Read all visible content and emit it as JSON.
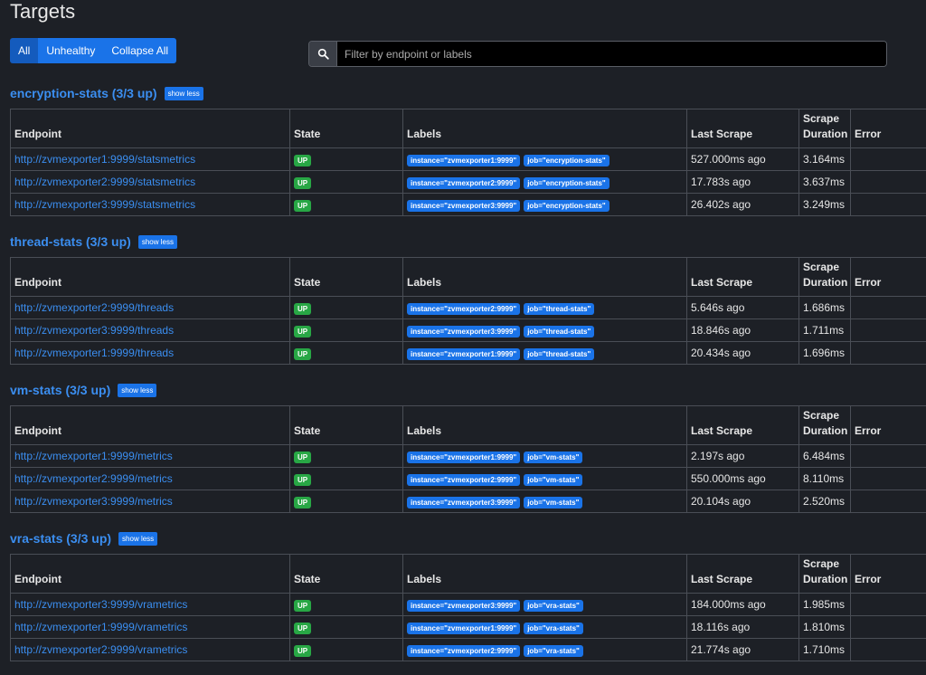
{
  "page": {
    "title": "Targets"
  },
  "filters": {
    "all": "All",
    "unhealthy": "Unhealthy",
    "collapse": "Collapse All"
  },
  "search": {
    "placeholder": "Filter by endpoint or labels"
  },
  "table_headers": {
    "endpoint": "Endpoint",
    "state": "State",
    "labels": "Labels",
    "last_scrape": "Last Scrape",
    "scrape_duration_1": "Scrape",
    "scrape_duration_2": "Duration",
    "error": "Error"
  },
  "show_less_label": "show less",
  "colors": {
    "accent": "#1a73e8",
    "link": "#3b8ef0",
    "up": "#28a745",
    "background": "#1d2026"
  },
  "sections": [
    {
      "title": "encryption-stats (3/3 up)",
      "rows": [
        {
          "endpoint": "http://zvmexporter1:9999/statsmetrics",
          "state": "UP",
          "labels": [
            "instance=\"zvmexporter1:9999\"",
            "job=\"encryption-stats\""
          ],
          "last_scrape": "527.000ms ago",
          "duration": "3.164ms",
          "error": ""
        },
        {
          "endpoint": "http://zvmexporter2:9999/statsmetrics",
          "state": "UP",
          "labels": [
            "instance=\"zvmexporter2:9999\"",
            "job=\"encryption-stats\""
          ],
          "last_scrape": "17.783s ago",
          "duration": "3.637ms",
          "error": ""
        },
        {
          "endpoint": "http://zvmexporter3:9999/statsmetrics",
          "state": "UP",
          "labels": [
            "instance=\"zvmexporter3:9999\"",
            "job=\"encryption-stats\""
          ],
          "last_scrape": "26.402s ago",
          "duration": "3.249ms",
          "error": ""
        }
      ]
    },
    {
      "title": "thread-stats (3/3 up)",
      "rows": [
        {
          "endpoint": "http://zvmexporter2:9999/threads",
          "state": "UP",
          "labels": [
            "instance=\"zvmexporter2:9999\"",
            "job=\"thread-stats\""
          ],
          "last_scrape": "5.646s ago",
          "duration": "1.686ms",
          "error": ""
        },
        {
          "endpoint": "http://zvmexporter3:9999/threads",
          "state": "UP",
          "labels": [
            "instance=\"zvmexporter3:9999\"",
            "job=\"thread-stats\""
          ],
          "last_scrape": "18.846s ago",
          "duration": "1.711ms",
          "error": ""
        },
        {
          "endpoint": "http://zvmexporter1:9999/threads",
          "state": "UP",
          "labels": [
            "instance=\"zvmexporter1:9999\"",
            "job=\"thread-stats\""
          ],
          "last_scrape": "20.434s ago",
          "duration": "1.696ms",
          "error": ""
        }
      ]
    },
    {
      "title": "vm-stats (3/3 up)",
      "rows": [
        {
          "endpoint": "http://zvmexporter1:9999/metrics",
          "state": "UP",
          "labels": [
            "instance=\"zvmexporter1:9999\"",
            "job=\"vm-stats\""
          ],
          "last_scrape": "2.197s ago",
          "duration": "6.484ms",
          "error": ""
        },
        {
          "endpoint": "http://zvmexporter2:9999/metrics",
          "state": "UP",
          "labels": [
            "instance=\"zvmexporter2:9999\"",
            "job=\"vm-stats\""
          ],
          "last_scrape": "550.000ms ago",
          "duration": "8.110ms",
          "error": ""
        },
        {
          "endpoint": "http://zvmexporter3:9999/metrics",
          "state": "UP",
          "labels": [
            "instance=\"zvmexporter3:9999\"",
            "job=\"vm-stats\""
          ],
          "last_scrape": "20.104s ago",
          "duration": "2.520ms",
          "error": ""
        }
      ]
    },
    {
      "title": "vra-stats (3/3 up)",
      "rows": [
        {
          "endpoint": "http://zvmexporter3:9999/vrametrics",
          "state": "UP",
          "labels": [
            "instance=\"zvmexporter3:9999\"",
            "job=\"vra-stats\""
          ],
          "last_scrape": "184.000ms ago",
          "duration": "1.985ms",
          "error": ""
        },
        {
          "endpoint": "http://zvmexporter1:9999/vrametrics",
          "state": "UP",
          "labels": [
            "instance=\"zvmexporter1:9999\"",
            "job=\"vra-stats\""
          ],
          "last_scrape": "18.116s ago",
          "duration": "1.810ms",
          "error": ""
        },
        {
          "endpoint": "http://zvmexporter2:9999/vrametrics",
          "state": "UP",
          "labels": [
            "instance=\"zvmexporter2:9999\"",
            "job=\"vra-stats\""
          ],
          "last_scrape": "21.774s ago",
          "duration": "1.710ms",
          "error": ""
        }
      ]
    }
  ]
}
